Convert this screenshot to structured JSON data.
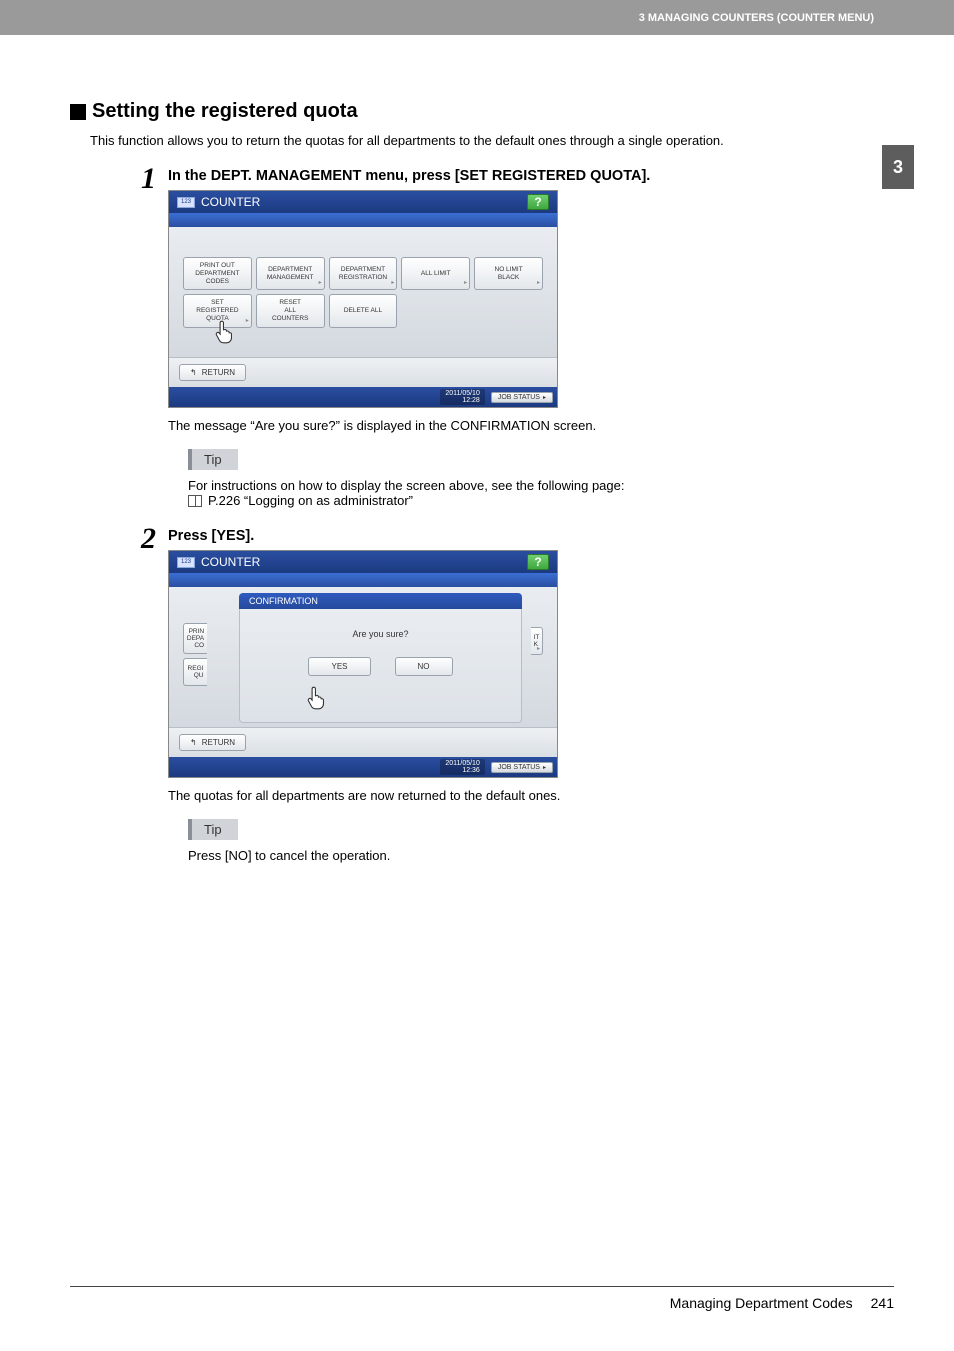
{
  "header": {
    "breadcrumb": "3 MANAGING COUNTERS (COUNTER MENU)"
  },
  "side_tab": "3",
  "section": {
    "title": "Setting the registered quota",
    "intro": "This function allows you to return the quotas for all departments to the default ones through a single operation."
  },
  "steps": [
    {
      "num": "1",
      "title": "In the DEPT. MANAGEMENT menu, press [SET REGISTERED QUOTA].",
      "result": "The message “Are you sure?” is displayed in the CONFIRMATION screen.",
      "tip": {
        "label": "Tip",
        "lines": [
          "For instructions on how to display the screen above, see the following page:"
        ],
        "ref": "P.226 “Logging on as administrator”"
      }
    },
    {
      "num": "2",
      "title": "Press [YES].",
      "result": "The quotas for all departments are now returned to the default ones.",
      "tip": {
        "label": "Tip",
        "lines": [
          "Press [NO] to cancel the operation."
        ]
      }
    }
  ],
  "screen1": {
    "title": "COUNTER",
    "counter_icon": "123",
    "help": "?",
    "buttons_row1": [
      {
        "label": "PRINT OUT\nDEPARTMENT\nCODES",
        "has_arrow": false
      },
      {
        "label": "DEPARTMENT\nMANAGEMENT",
        "has_arrow": true
      },
      {
        "label": "DEPARTMENT\nREGISTRATION",
        "has_arrow": true
      },
      {
        "label": "ALL LIMIT",
        "has_arrow": true
      },
      {
        "label": "NO LIMIT\nBLACK",
        "has_arrow": true
      }
    ],
    "buttons_row2": [
      {
        "label": "SET\nREGISTERED\nQUOTA",
        "has_arrow": true
      },
      {
        "label": "RESET\nALL\nCOUNTERS",
        "has_arrow": false
      },
      {
        "label": "DELETE ALL",
        "has_arrow": false
      }
    ],
    "return": "RETURN",
    "timestamp": "2011/05/10\n12:28",
    "jobstatus": "JOB STATUS"
  },
  "screen2": {
    "title": "COUNTER",
    "counter_icon": "123",
    "help": "?",
    "modal": {
      "header": "CONFIRMATION",
      "message": "Are you sure?",
      "yes": "YES",
      "no": "NO"
    },
    "bg_stub_left_top": "PRIN\nDEPA\nCO",
    "bg_stub_left_bot": "REGI\nQU",
    "bg_stub_right": "IT\nK",
    "return": "RETURN",
    "timestamp": "2011/05/10\n12:36",
    "jobstatus": "JOB STATUS"
  },
  "footer": {
    "section_title": "Managing Department Codes",
    "page_number": "241"
  }
}
